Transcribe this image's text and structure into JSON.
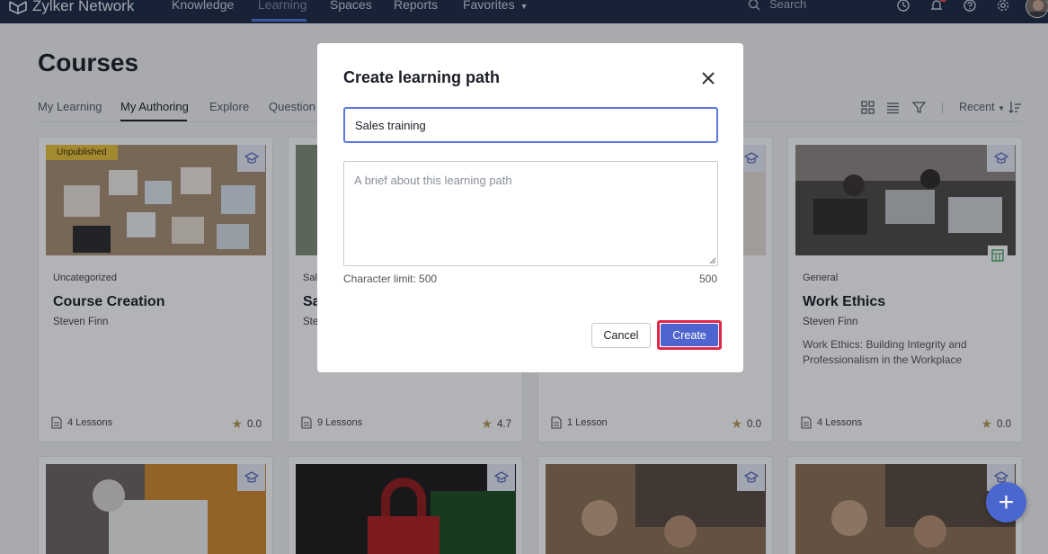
{
  "nav": {
    "brand": "Zylker Network",
    "items": [
      "Knowledge",
      "Learning",
      "Spaces",
      "Reports",
      "Favorites"
    ],
    "active": "Learning",
    "search_label": "Search"
  },
  "page": {
    "title": "Courses",
    "tabs": [
      "My Learning",
      "My Authoring",
      "Explore",
      "Question"
    ],
    "active_tab": "My Authoring",
    "sort_label": "Recent"
  },
  "cards": [
    {
      "status": "Unpublished",
      "category": "Uncategorized",
      "title": "Course Creation",
      "author": "Steven Finn",
      "description": "",
      "lessons": "4 Lessons",
      "rating": "0.0"
    },
    {
      "status": "",
      "category": "Sale",
      "title": "Sa",
      "author": "Stev",
      "description": "",
      "lessons": "9 Lessons",
      "rating": "4.7"
    },
    {
      "status": "",
      "category": "",
      "title": "",
      "author": "",
      "description": "",
      "lessons": "1 Lesson",
      "rating": "0.0"
    },
    {
      "status": "",
      "category": "General",
      "title": "Work Ethics",
      "author": "Steven Finn",
      "description": "Work Ethics: Building Integrity and Professionalism in the Workplace",
      "lessons": "4 Lessons",
      "rating": "0.0"
    }
  ],
  "modal": {
    "title": "Create learning path",
    "name_value": "Sales training",
    "description_placeholder": "A brief about this learning path",
    "char_limit_label": "Character limit: 500",
    "char_count": "500",
    "cancel_label": "Cancel",
    "create_label": "Create"
  },
  "colors": {
    "nav_bg": "#1d2a44",
    "accent": "#4e65cf",
    "highlight": "#e0294a",
    "unpublished_badge": "#e9c23a",
    "star": "#b89b5e"
  },
  "icons": [
    "zylker-logo-icon",
    "search-icon",
    "clock-icon",
    "bell-icon",
    "help-icon",
    "gear-icon",
    "grid-view-icon",
    "list-view-icon",
    "filter-icon",
    "sort-icon",
    "course-cap-icon",
    "file-icon",
    "star-icon",
    "close-icon",
    "plus-icon"
  ]
}
